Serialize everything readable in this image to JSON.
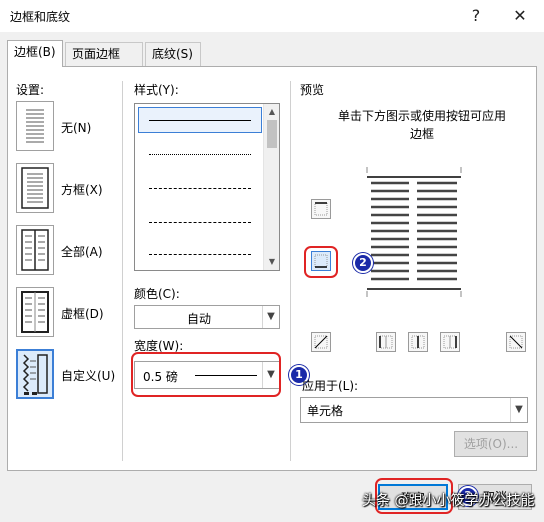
{
  "window": {
    "title": "边框和底纹",
    "help_glyph": "?",
    "close_glyph": "✕"
  },
  "tabs": [
    {
      "label": "边框(B)",
      "active": true
    },
    {
      "label": "页面边框(P)",
      "active": false
    },
    {
      "label": "底纹(S)",
      "active": false
    }
  ],
  "settings": {
    "heading": "设置:",
    "items": [
      {
        "label": "无(N)",
        "icon": "border-none-icon"
      },
      {
        "label": "方框(X)",
        "icon": "border-box-icon"
      },
      {
        "label": "全部(A)",
        "icon": "border-all-icon"
      },
      {
        "label": "虚框(D)",
        "icon": "border-grid-icon"
      },
      {
        "label": "自定义(U)",
        "icon": "border-custom-icon",
        "selected": true
      }
    ]
  },
  "style": {
    "heading": "样式(Y):",
    "line_styles": [
      "solid",
      "dotted",
      "dashed-small",
      "dashed",
      "dash-dot"
    ]
  },
  "color": {
    "label": "颜色(C):",
    "value": "自动"
  },
  "width": {
    "label": "宽度(W):",
    "value": "0.5 磅"
  },
  "preview": {
    "heading": "预览",
    "hint": "单击下方图示或使用按钮可应用边框"
  },
  "apply_to": {
    "label": "应用于(L):",
    "value": "单元格"
  },
  "options_button": "选项(O)...",
  "ok_button": "确定",
  "cancel_button": "取消",
  "annotations": {
    "badge1": "1",
    "badge2": "2",
    "badge3": "3",
    "color": "#e02424"
  },
  "watermark": "头条 @跟小小筱学办公技能"
}
